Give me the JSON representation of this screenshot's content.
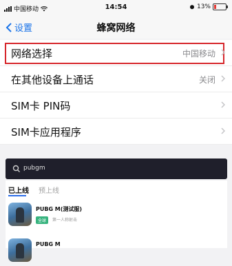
{
  "status_bar": {
    "carrier": "中国移动",
    "time": "14:54",
    "battery_text": "13%"
  },
  "navbar": {
    "back_label": "设置",
    "title": "蜂窝网络"
  },
  "settings_rows": [
    {
      "label": "网络选择",
      "value": "中国移动",
      "highlighted": true
    },
    {
      "label": "在其他设备上通话",
      "value": "关闭"
    },
    {
      "label": "SIM卡 PIN码",
      "value": ""
    },
    {
      "label": "SIM卡应用程序",
      "value": ""
    }
  ],
  "search": {
    "query": "pubgm"
  },
  "tabs": [
    {
      "label": "已上线",
      "active": true
    },
    {
      "label": "预上线",
      "active": false
    }
  ],
  "apps": [
    {
      "name": "PUBG M(测试服)",
      "badge": "全球",
      "subtitle": "第一人称射击"
    },
    {
      "name": "PUBG M",
      "badge": "",
      "subtitle": ""
    }
  ],
  "colors": {
    "accent": "#1a73e8",
    "highlight_border": "#d6262b",
    "search_bg": "#1f1f2b",
    "tab_underline": "#2b6de8"
  }
}
